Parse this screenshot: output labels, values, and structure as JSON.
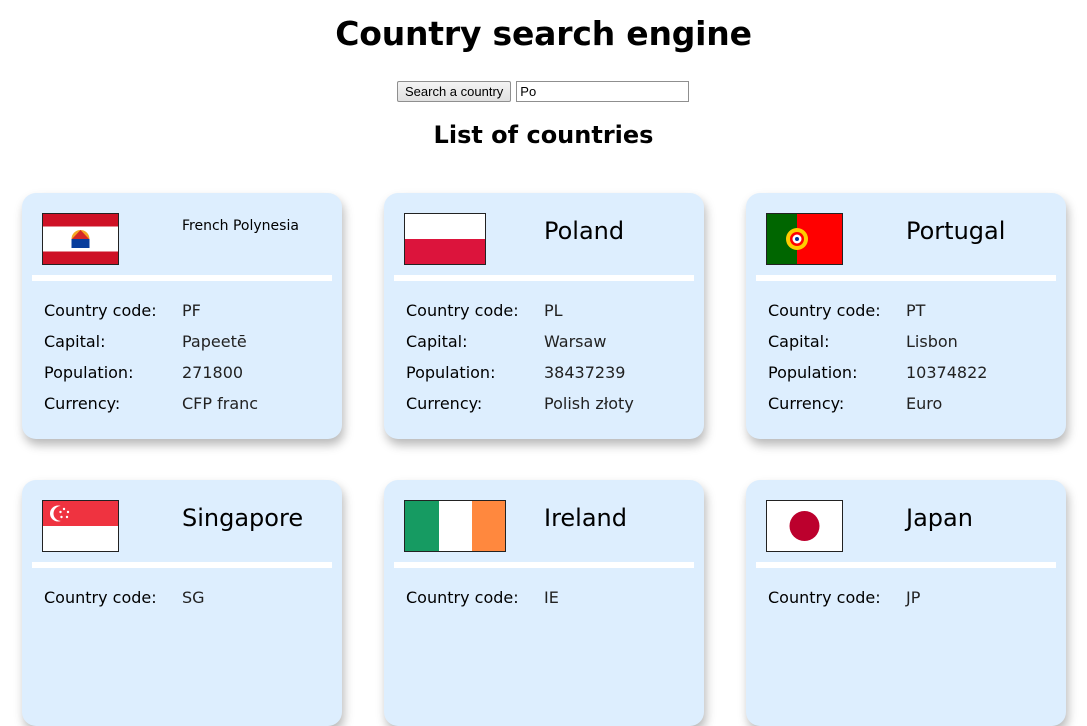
{
  "header": {
    "title": "Country search engine",
    "subtitle": "List of countries"
  },
  "search": {
    "button_label": "Search a country",
    "value": "Po"
  },
  "labels": {
    "code": "Country code:",
    "capital": "Capital:",
    "population": "Population:",
    "currency": "Currency:"
  },
  "cards": [
    {
      "name": "French Polynesia",
      "code": "PF",
      "capital": "Papeetē",
      "population": "271800",
      "currency": "CFP franc"
    },
    {
      "name": "Poland",
      "code": "PL",
      "capital": "Warsaw",
      "population": "38437239",
      "currency": "Polish złoty"
    },
    {
      "name": "Portugal",
      "code": "PT",
      "capital": "Lisbon",
      "population": "10374822",
      "currency": "Euro"
    },
    {
      "name": "Singapore",
      "code": "SG",
      "capital": "",
      "population": "",
      "currency": ""
    },
    {
      "name": "Ireland",
      "code": "IE",
      "capital": "",
      "population": "",
      "currency": ""
    },
    {
      "name": "Japan",
      "code": "JP",
      "capital": "",
      "population": "",
      "currency": ""
    }
  ],
  "colors": {
    "card_bg": "#ddeefe",
    "divider": "#ffffff"
  }
}
